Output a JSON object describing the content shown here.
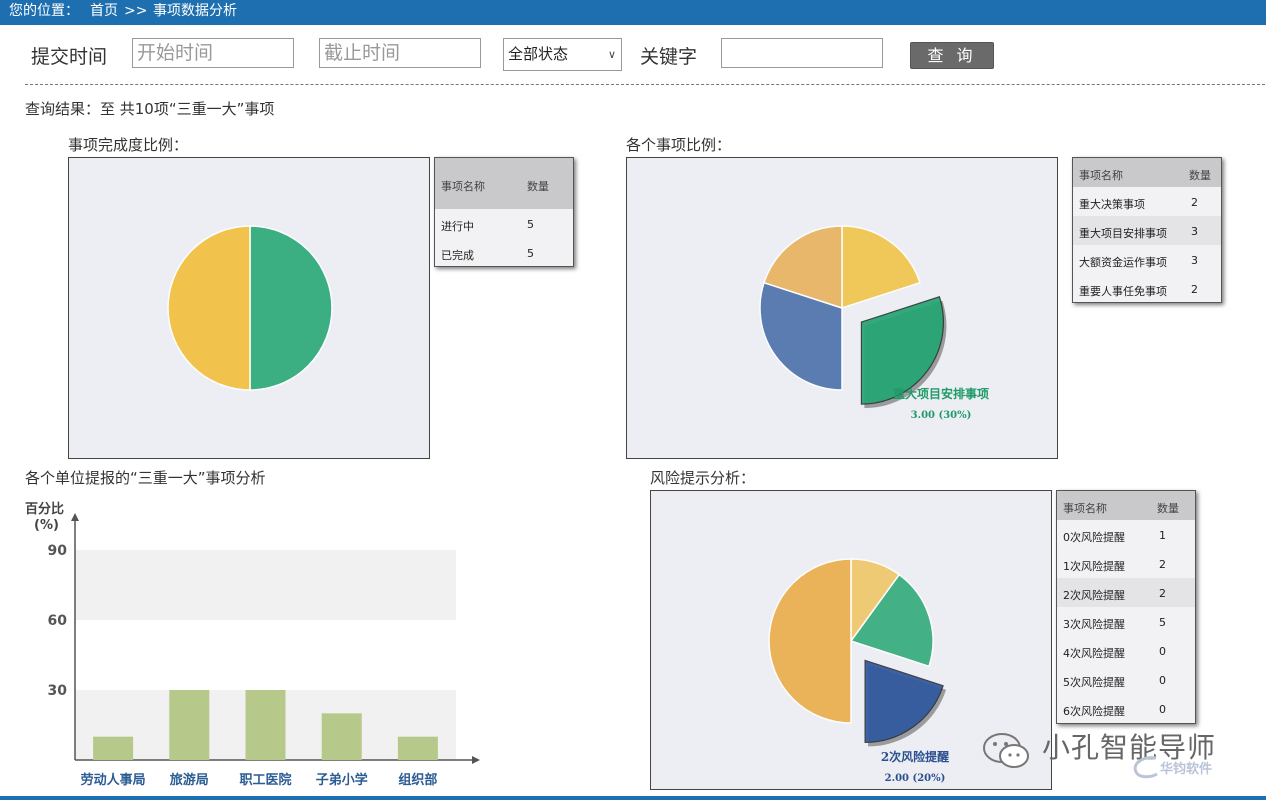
{
  "topbar": {
    "location_label": "您的位置：",
    "breadcrumb_home": "首页",
    "breadcrumb_sep": ">>",
    "breadcrumb_current": "事项数据分析"
  },
  "filters": {
    "submit_time_label": "提交时间",
    "start_placeholder": "开始时间",
    "end_placeholder": "截止时间",
    "status_selected": "全部状态",
    "keyword_label": "关键字",
    "keyword_value": "",
    "search_button": "查 询"
  },
  "result_text": "查询结果：至 共10项“三重一大”事项",
  "completion": {
    "title": "事项完成度比例：",
    "legend_headers": [
      "事项名称",
      "数量"
    ],
    "rows": [
      {
        "name": "进行中",
        "count": "5"
      },
      {
        "name": "已完成",
        "count": "5"
      }
    ],
    "chart_data": {
      "type": "pie",
      "categories": [
        "进行中",
        "已完成"
      ],
      "values": [
        5,
        5
      ],
      "colors": [
        "#2daa78",
        "#f2bf3e"
      ]
    }
  },
  "items": {
    "title": "各个事项比例：",
    "legend_headers": [
      "事项名称",
      "数量"
    ],
    "rows": [
      {
        "name": "重大决策事项",
        "count": "2"
      },
      {
        "name": "重大项目安排事项",
        "count": "3"
      },
      {
        "name": "大额资金运作事项",
        "count": "3"
      },
      {
        "name": "重要人事任免事项",
        "count": "2"
      }
    ],
    "chart_data": {
      "type": "pie",
      "categories": [
        "重大决策事项",
        "重大项目安排事项",
        "大额资金运作事项",
        "重要人事任免事项"
      ],
      "values": [
        2,
        3,
        3,
        2
      ],
      "colors": [
        "#f0c54d",
        "#24a572",
        "#4f73ac",
        "#e9b360"
      ],
      "highlight_label": "重大项目安排事项",
      "highlight_value": "3.00 (30%)",
      "highlight_color": "#1f9a68"
    }
  },
  "units": {
    "title": "各个单位提报的“三重一大”事项分析",
    "y_unit_line1": "百分比",
    "y_unit_line2": "(%)",
    "chart_data": {
      "type": "bar",
      "categories": [
        "劳动人事局",
        "旅游局",
        "职工医院",
        "子弟小学",
        "组织部"
      ],
      "values": [
        10,
        30,
        30,
        20,
        10
      ],
      "yticks": [
        30,
        60,
        90
      ],
      "ylim": [
        0,
        90
      ],
      "bar_color": "#b7c98a",
      "label_color": "#2b5c93"
    }
  },
  "risk": {
    "title": "风险提示分析：",
    "legend_headers": [
      "事项名称",
      "数量"
    ],
    "rows": [
      {
        "name": "0次风险提醒",
        "count": "1"
      },
      {
        "name": "1次风险提醒",
        "count": "2"
      },
      {
        "name": "2次风险提醒",
        "count": "2"
      },
      {
        "name": "3次风险提醒",
        "count": "5"
      },
      {
        "name": "4次风险提醒",
        "count": "0"
      },
      {
        "name": "5次风险提醒",
        "count": "0"
      },
      {
        "name": "6次风险提醒",
        "count": "0"
      }
    ],
    "chart_data": {
      "type": "pie",
      "categories": [
        "0次风险提醒",
        "1次风险提醒",
        "2次风险提醒",
        "3次风险提醒",
        "4次风险提醒",
        "5次风险提醒",
        "6次风险提醒"
      ],
      "values": [
        1,
        2,
        2,
        5,
        0,
        0,
        0
      ],
      "colors": [
        "#f0c86a",
        "#35ab7d",
        "#2f58a0",
        "#eaaf4c",
        "#999999",
        "#999999",
        "#999999"
      ],
      "highlight_label": "2次风险提醒",
      "highlight_value": "2.00 (20%)",
      "highlight_color": "#2b4f8e"
    }
  },
  "watermark": {
    "text": "小孔智能导师",
    "brand": "华钧软件"
  }
}
